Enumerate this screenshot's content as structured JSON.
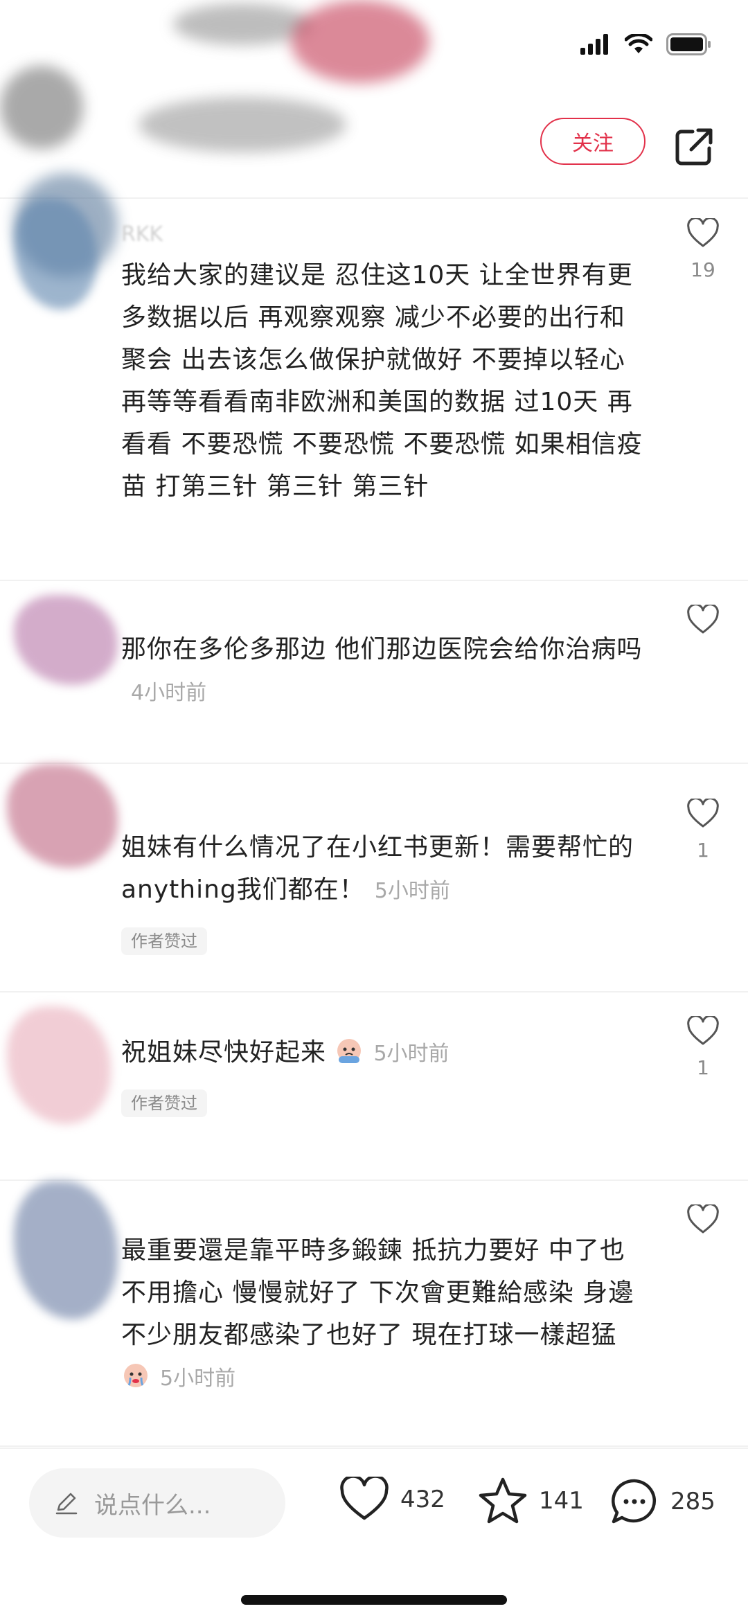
{
  "header": {
    "follow_label": "关注"
  },
  "comments": [
    {
      "text": "我给大家的建议是 忍住这10天 让全世界有更多数据以后 再观察观察 减少不必要的出行和聚会 出去该怎么做保护就做好 不要掉以轻心 再等等看看南非欧洲和美国的数据 过10天 再看看 不要恐慌 不要恐慌 不要恐慌 如果相信疫苗 打第三针 第三针 第三针",
      "time": "",
      "likes": "19",
      "author_liked": ""
    },
    {
      "text": "那你在多伦多那边 他们那边医院会给你治病吗",
      "time": "4小时前",
      "likes": "",
      "author_liked": ""
    },
    {
      "text": "姐妹有什么情况了在小红书更新！需要帮忙的anything我们都在！",
      "time": "5小时前",
      "likes": "1",
      "author_liked": "作者赞过"
    },
    {
      "text": "祝姐妹尽快好起来",
      "time": "5小时前",
      "likes": "1",
      "author_liked": "作者赞过",
      "emoji": "crying-emoji"
    },
    {
      "text": "最重要還是靠平時多鍛鍊 抵抗力要好 中了也不用擔心 慢慢就好了 下次會更難給感染 身邊不少朋友都感染了也好了 現在打球一樣超猛",
      "time": "5小时前",
      "likes": "",
      "author_liked": "",
      "emoji": "crying-emoji"
    }
  ],
  "bottom_bar": {
    "input_placeholder": "说点什么...",
    "likes": "432",
    "stars": "141",
    "comments": "285"
  },
  "icons": {
    "signal": "cellular-signal-icon",
    "wifi": "wifi-icon",
    "battery": "battery-icon",
    "share": "share-icon",
    "heart": "heart-icon",
    "star": "star-icon",
    "comment": "comment-bubble-icon",
    "pencil": "pencil-icon"
  },
  "colors": {
    "accent": "#e2314a",
    "muted": "#a8a8a8"
  }
}
